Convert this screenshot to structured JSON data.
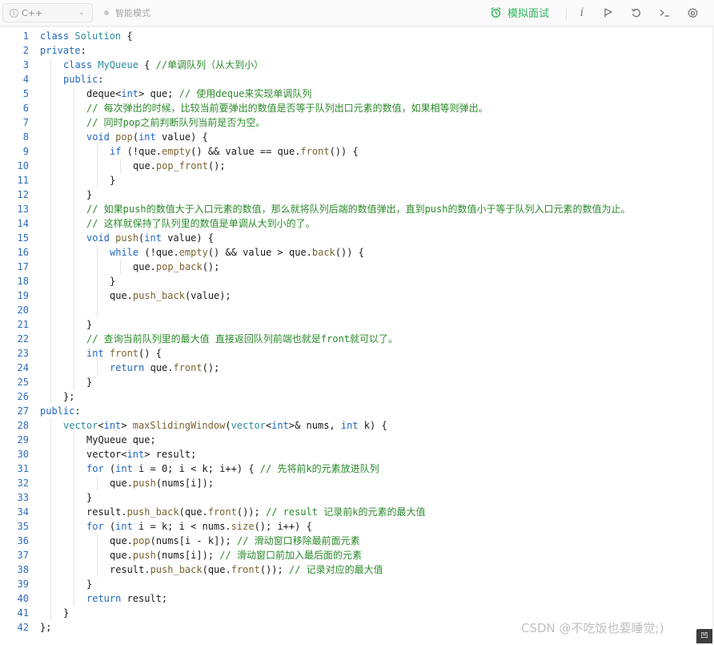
{
  "toolbar": {
    "language": "C++",
    "smart_mode": "智能模式",
    "mock_interview": "模拟面试",
    "icons": [
      "info-icon",
      "run-icon",
      "reset-icon",
      "terminal-icon",
      "settings-icon"
    ]
  },
  "colors": {
    "accent_green": "#2db55d",
    "keyword_blue": "#1f66c2",
    "comment_green": "#2b8a2b",
    "line_number_blue": "#2f6bbd"
  },
  "code": [
    {
      "n": "1",
      "indent": 0,
      "tokens": [
        [
          "kw",
          "class"
        ],
        [
          "",
          "&nbsp;"
        ],
        [
          "cl",
          "Solution"
        ],
        [
          "",
          " {"
        ]
      ]
    },
    {
      "n": "2",
      "indent": 0,
      "tokens": [
        [
          "kw",
          "private"
        ],
        [
          "",
          ":"
        ]
      ]
    },
    {
      "n": "3",
      "indent": 1,
      "tokens": [
        [
          "kw",
          "class"
        ],
        [
          "",
          " "
        ],
        [
          "cl",
          "MyQueue"
        ],
        [
          "",
          " { "
        ],
        [
          "cm",
          "//单调队列（从大到小）"
        ]
      ]
    },
    {
      "n": "4",
      "indent": 1,
      "tokens": [
        [
          "kw",
          "public"
        ],
        [
          "",
          ":"
        ]
      ]
    },
    {
      "n": "5",
      "indent": 2,
      "tokens": [
        [
          "",
          "deque<"
        ],
        [
          "ty",
          "int"
        ],
        [
          "",
          "> que; "
        ],
        [
          "cm",
          "// 使用deque来实现单调队列"
        ]
      ]
    },
    {
      "n": "6",
      "indent": 2,
      "tokens": [
        [
          "cm",
          "// 每次弹出的时候，比较当前要弹出的数值是否等于队列出口元素的数值，如果相等则弹出。"
        ]
      ]
    },
    {
      "n": "7",
      "indent": 2,
      "tokens": [
        [
          "cm",
          "// 同时pop之前判断队列当前是否为空。"
        ]
      ]
    },
    {
      "n": "8",
      "indent": 2,
      "tokens": [
        [
          "ty",
          "void"
        ],
        [
          "",
          " "
        ],
        [
          "fn",
          "pop"
        ],
        [
          "",
          "("
        ],
        [
          "ty",
          "int"
        ],
        [
          "",
          " value) {"
        ]
      ]
    },
    {
      "n": "9",
      "indent": 3,
      "tokens": [
        [
          "kw",
          "if"
        ],
        [
          "",
          " (!que."
        ],
        [
          "fn",
          "empty"
        ],
        [
          "",
          "() && value == que."
        ],
        [
          "fn",
          "front"
        ],
        [
          "",
          "()) {"
        ]
      ]
    },
    {
      "n": "10",
      "indent": 4,
      "tokens": [
        [
          "",
          "que."
        ],
        [
          "fn",
          "pop_front"
        ],
        [
          "",
          "();"
        ]
      ]
    },
    {
      "n": "11",
      "indent": 3,
      "tokens": [
        [
          "",
          "}"
        ]
      ]
    },
    {
      "n": "12",
      "indent": 2,
      "tokens": [
        [
          "",
          "}"
        ]
      ]
    },
    {
      "n": "13",
      "indent": 2,
      "tokens": [
        [
          "cm",
          "// 如果push的数值大于入口元素的数值，那么就将队列后端的数值弹出，直到push的数值小于等于队列入口元素的数值为止。"
        ]
      ]
    },
    {
      "n": "14",
      "indent": 2,
      "tokens": [
        [
          "cm",
          "// 这样就保持了队列里的数值是单调从大到小的了。"
        ]
      ]
    },
    {
      "n": "15",
      "indent": 2,
      "tokens": [
        [
          "ty",
          "void"
        ],
        [
          "",
          " "
        ],
        [
          "fn",
          "push"
        ],
        [
          "",
          "("
        ],
        [
          "ty",
          "int"
        ],
        [
          "",
          " value) {"
        ]
      ]
    },
    {
      "n": "16",
      "indent": 3,
      "tokens": [
        [
          "kw",
          "while"
        ],
        [
          "",
          " (!que."
        ],
        [
          "fn",
          "empty"
        ],
        [
          "",
          "() && value > que."
        ],
        [
          "fn",
          "back"
        ],
        [
          "",
          "()) {"
        ]
      ]
    },
    {
      "n": "17",
      "indent": 4,
      "tokens": [
        [
          "",
          "que."
        ],
        [
          "fn",
          "pop_back"
        ],
        [
          "",
          "();"
        ]
      ]
    },
    {
      "n": "18",
      "indent": 3,
      "tokens": [
        [
          "",
          "}"
        ]
      ]
    },
    {
      "n": "19",
      "indent": 3,
      "tokens": [
        [
          "",
          "que."
        ],
        [
          "fn",
          "push_back"
        ],
        [
          "",
          "(value);"
        ]
      ]
    },
    {
      "n": "20",
      "indent": 3,
      "tokens": []
    },
    {
      "n": "21",
      "indent": 2,
      "tokens": [
        [
          "",
          "}"
        ]
      ]
    },
    {
      "n": "22",
      "indent": 2,
      "tokens": [
        [
          "cm",
          "// 查询当前队列里的最大值 直接返回队列前端也就是front就可以了。"
        ]
      ]
    },
    {
      "n": "23",
      "indent": 2,
      "tokens": [
        [
          "ty",
          "int"
        ],
        [
          "",
          " "
        ],
        [
          "fn",
          "front"
        ],
        [
          "",
          "() {"
        ]
      ]
    },
    {
      "n": "24",
      "indent": 3,
      "tokens": [
        [
          "kw",
          "return"
        ],
        [
          "",
          " que."
        ],
        [
          "fn",
          "front"
        ],
        [
          "",
          "();"
        ]
      ]
    },
    {
      "n": "25",
      "indent": 2,
      "tokens": [
        [
          "",
          "}"
        ]
      ]
    },
    {
      "n": "26",
      "indent": 1,
      "tokens": [
        [
          "",
          "};"
        ]
      ]
    },
    {
      "n": "27",
      "indent": 0,
      "tokens": [
        [
          "kw",
          "public"
        ],
        [
          "",
          ":"
        ]
      ]
    },
    {
      "n": "28",
      "indent": 1,
      "tokens": [
        [
          "cl",
          "vector"
        ],
        [
          "",
          "<"
        ],
        [
          "ty",
          "int"
        ],
        [
          "",
          "> "
        ],
        [
          "fn",
          "maxSlidingWindow"
        ],
        [
          "",
          "("
        ],
        [
          "cl",
          "vector"
        ],
        [
          "",
          "<"
        ],
        [
          "ty",
          "int"
        ],
        [
          "",
          ">& nums, "
        ],
        [
          "ty",
          "int"
        ],
        [
          "",
          " k) {"
        ]
      ]
    },
    {
      "n": "29",
      "indent": 2,
      "tokens": [
        [
          "",
          "MyQueue que;"
        ]
      ]
    },
    {
      "n": "30",
      "indent": 2,
      "tokens": [
        [
          "",
          "vector<"
        ],
        [
          "ty",
          "int"
        ],
        [
          "",
          "> result;"
        ]
      ]
    },
    {
      "n": "31",
      "indent": 2,
      "tokens": [
        [
          "kw",
          "for"
        ],
        [
          "",
          " ("
        ],
        [
          "ty",
          "int"
        ],
        [
          "",
          " i = 0; i < k; i++) { "
        ],
        [
          "cm",
          "// 先将前k的元素放进队列"
        ]
      ]
    },
    {
      "n": "32",
      "indent": 3,
      "tokens": [
        [
          "",
          "que."
        ],
        [
          "fn",
          "push"
        ],
        [
          "",
          "(nums[i]);"
        ]
      ]
    },
    {
      "n": "33",
      "indent": 2,
      "tokens": [
        [
          "",
          "}"
        ]
      ]
    },
    {
      "n": "34",
      "indent": 2,
      "tokens": [
        [
          "",
          "result."
        ],
        [
          "fn",
          "push_back"
        ],
        [
          "",
          "(que."
        ],
        [
          "fn",
          "front"
        ],
        [
          "",
          "()); "
        ],
        [
          "cm",
          "// result 记录前k的元素的最大值"
        ]
      ]
    },
    {
      "n": "35",
      "indent": 2,
      "tokens": [
        [
          "kw",
          "for"
        ],
        [
          "",
          " ("
        ],
        [
          "ty",
          "int"
        ],
        [
          "",
          " i = k; i < nums."
        ],
        [
          "fn",
          "size"
        ],
        [
          "",
          "(); i++) {"
        ]
      ]
    },
    {
      "n": "36",
      "indent": 3,
      "tokens": [
        [
          "",
          "que."
        ],
        [
          "fn",
          "pop"
        ],
        [
          "",
          "(nums[i - k]); "
        ],
        [
          "cm",
          "// 滑动窗口移除最前面元素"
        ]
      ]
    },
    {
      "n": "37",
      "indent": 3,
      "tokens": [
        [
          "",
          "que."
        ],
        [
          "fn",
          "push"
        ],
        [
          "",
          "(nums[i]); "
        ],
        [
          "cm",
          "// 滑动窗口前加入最后面的元素"
        ]
      ]
    },
    {
      "n": "38",
      "indent": 3,
      "tokens": [
        [
          "",
          "result."
        ],
        [
          "fn",
          "push_back"
        ],
        [
          "",
          "(que."
        ],
        [
          "fn",
          "front"
        ],
        [
          "",
          "()); "
        ],
        [
          "cm",
          "// 记录对应的最大值"
        ]
      ]
    },
    {
      "n": "39",
      "indent": 2,
      "tokens": [
        [
          "",
          "}"
        ]
      ]
    },
    {
      "n": "40",
      "indent": 2,
      "tokens": [
        [
          "kw",
          "return"
        ],
        [
          "",
          " result;"
        ]
      ]
    },
    {
      "n": "41",
      "indent": 1,
      "tokens": [
        [
          "",
          "}"
        ]
      ]
    },
    {
      "n": "42",
      "indent": 0,
      "tokens": [
        [
          "",
          "};"
        ]
      ]
    }
  ],
  "watermark": "CSDN @不吃饭也要睡觉;)"
}
